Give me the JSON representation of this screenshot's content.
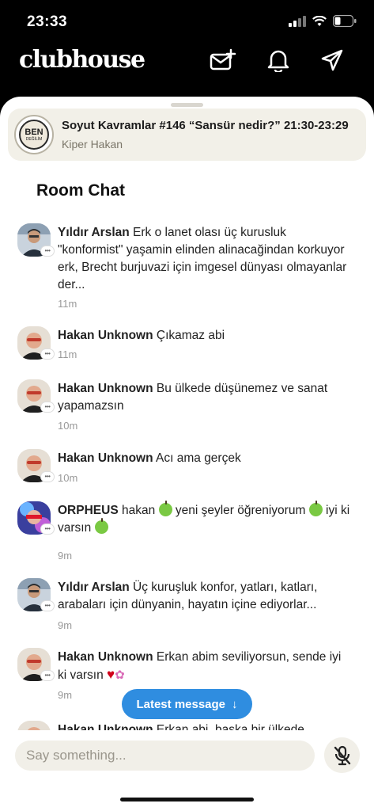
{
  "status_bar": {
    "time": "23:33"
  },
  "header": {
    "app_name": "clubhouse"
  },
  "room": {
    "avatar_text_main": "BEN",
    "avatar_text_sub": "DEĞİLİM",
    "title": "Soyut Kavramlar #146 “Sansür nedir?” 21:30-23:29",
    "host": "Kiper Hakan"
  },
  "chat": {
    "title": "Room Chat",
    "messages": [
      {
        "name": "Yıldır Arslan",
        "text": "Erk o lanet olası üç kurusluk \"konformist\" yaşamin  elinden alinacağindan korkuyor erk, Brecht burjuvazi için imgesel dünyası olmayanlar der...",
        "time": "11m",
        "avatar": "yildir-avatar"
      },
      {
        "name": "Hakan Unknown",
        "text": "Çıkamaz abi",
        "time": "11m",
        "avatar": "hakan-avatar"
      },
      {
        "name": "Hakan Unknown",
        "text": "Bu ülkede düşünemez ve sanat yapamazsın",
        "time": "10m",
        "avatar": "hakan-avatar"
      },
      {
        "name": "Hakan Unknown",
        "text": "Acı ama gerçek",
        "time": "10m",
        "avatar": "hakan-avatar"
      },
      {
        "name": "ORPHEUS",
        "text_parts": [
          "hakan",
          "yeni şeyler öğreniyorum",
          "iyi ki varsın"
        ],
        "time": "9m",
        "avatar": "orpheus-avatar"
      },
      {
        "name": "Yıldır Arslan",
        "text": "Üç kuruşluk konfor, yatları, katları, arabaları için dünyanin, hayatın içine ediyorlar...",
        "time": "9m",
        "avatar": "yildir-avatar"
      },
      {
        "name": "Hakan Unknown",
        "text": "Erkan abim seviliyorsun, sende iyi ki varsın",
        "time": "9m",
        "avatar": "hakan-avatar"
      },
      {
        "name": "Hakan Unknown",
        "text": "Erkan abi, başka bir ülkede",
        "time": "",
        "avatar": "hakan-avatar"
      }
    ]
  },
  "latest_button": {
    "label": "Latest message",
    "arrow": "↓"
  },
  "composer": {
    "placeholder": "Say something..."
  }
}
